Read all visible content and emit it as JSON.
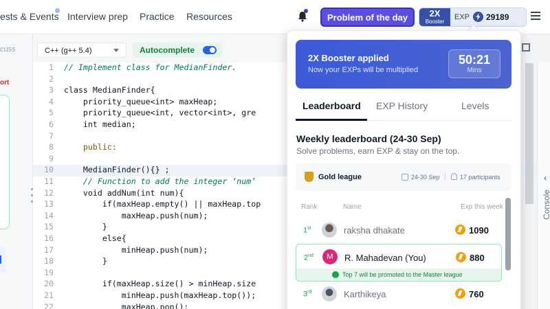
{
  "nav": {
    "items": [
      "ests & Events",
      "Interview prep",
      "Practice",
      "Resources"
    ],
    "potd_label": "Problem of the day",
    "booster": {
      "multiplier": "2X",
      "label": "Booster"
    },
    "exp_label": "EXP",
    "exp_value": "29189"
  },
  "left_pane": {
    "tab_text": "cuss",
    "red_text": "ort"
  },
  "editor": {
    "language": "C++ (g++ 5.4)",
    "autocomplete_label": "Autocomplete",
    "autocomplete_on": true,
    "lines": [
      {
        "n": "1",
        "text": "// Implement class for MedianFinder."
      },
      {
        "n": "2",
        "text": ""
      },
      {
        "n": "3",
        "text": "class MedianFinder{"
      },
      {
        "n": "4",
        "text": "    priority_queue<int> maxHeap;"
      },
      {
        "n": "5",
        "text": "    priority_queue<int, vector<int>, gre"
      },
      {
        "n": "6",
        "text": "    int median;"
      },
      {
        "n": "7",
        "text": ""
      },
      {
        "n": "8",
        "text": "    public:"
      },
      {
        "n": "9",
        "text": ""
      },
      {
        "n": "10",
        "text": "    MedianFinder(){} ;"
      },
      {
        "n": "11",
        "text": "    // Function to add the integer ‘num’"
      },
      {
        "n": "12",
        "text": "    void addNum(int num){"
      },
      {
        "n": "13",
        "text": "        if(maxHeap.empty() || maxHeap.top"
      },
      {
        "n": "14",
        "text": "            maxHeap.push(num);"
      },
      {
        "n": "15",
        "text": "        }"
      },
      {
        "n": "16",
        "text": "        else{"
      },
      {
        "n": "17",
        "text": "            minHeap.push(num);"
      },
      {
        "n": "18",
        "text": "        }"
      },
      {
        "n": "19",
        "text": ""
      },
      {
        "n": "20",
        "text": "        if(maxHeap.size() > minHeap.size"
      },
      {
        "n": "21",
        "text": "            minHeap.push(maxHeap.top());"
      },
      {
        "n": "22",
        "text": "            maxHeap.pop();"
      }
    ]
  },
  "console_label": "Console",
  "panel": {
    "banner": {
      "title": "2X Booster applied",
      "subtitle": "Now your EXPs will be multiplied",
      "timer": "50:21",
      "timer_unit": "Mins"
    },
    "tabs": [
      "Leaderboard",
      "EXP History",
      "Levels"
    ],
    "title": "Weekly leaderboard (24-30 Sep)",
    "subtitle": "Solve problems, earn EXP & stay on the top.",
    "league": {
      "name": "Gold league",
      "dates": "24-30 Sep",
      "participants": "17 participants"
    },
    "columns": {
      "rank": "Rank",
      "name": "Name",
      "exp": "Exp this week"
    },
    "rows": [
      {
        "rank": "1",
        "suffix": "st",
        "name": "raksha dhakate",
        "exp": "1090",
        "avatar": "photo",
        "initial": ""
      },
      {
        "rank": "2",
        "suffix": "nd",
        "name": "R. Mahadevan (You)",
        "exp": "880",
        "avatar": "initial",
        "initial": "M"
      },
      {
        "rank": "3",
        "suffix": "rd",
        "name": "Karthikeya",
        "exp": "760",
        "avatar": "photo",
        "initial": ""
      }
    ],
    "promo_text": "Top 7 will be promoted to the Master league"
  }
}
